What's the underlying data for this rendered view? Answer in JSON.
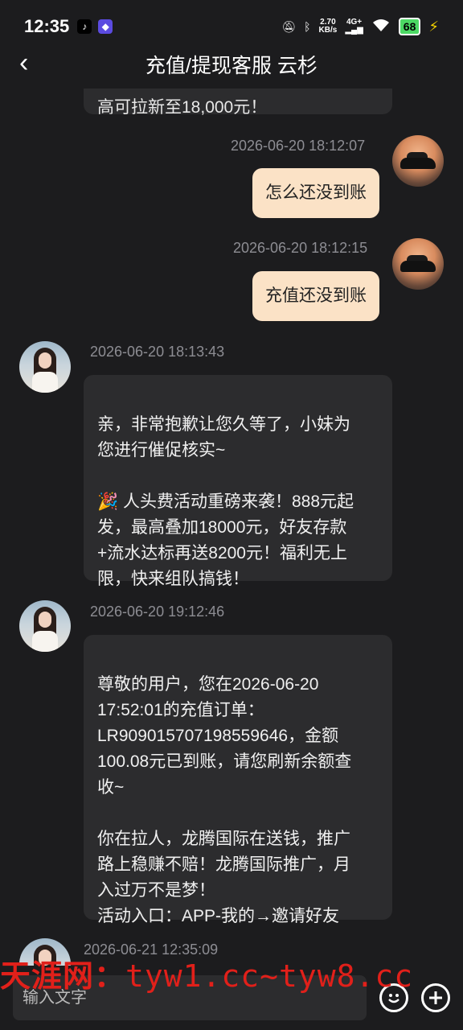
{
  "status_bar": {
    "time": "12:35",
    "net_speed_value": "2.70",
    "net_speed_unit": "KB/s",
    "signal_label": "4G+",
    "battery": "68"
  },
  "header": {
    "title": "充值/提现客服 云杉"
  },
  "messages": [
    {
      "side": "left",
      "partial": true,
      "text": "高可拉新至18,000元！"
    },
    {
      "side": "right",
      "timestamp": "2026-06-20 18:12:07",
      "text": "怎么还没到账"
    },
    {
      "side": "right",
      "timestamp": "2026-06-20 18:12:15",
      "text": "充值还没到账"
    },
    {
      "side": "left",
      "timestamp": "2026-06-20 18:13:43",
      "text": "亲，非常抱歉让您久等了，小妹为\n您进行催促核实~\n\n🎉 人头费活动重磅来袭！888元起\n发，最高叠加18000元，好友存款\n+流水达标再送8200元！福利无上\n限，快来组队搞钱！"
    },
    {
      "side": "left",
      "timestamp": "2026-06-20 19:12:46",
      "text": "尊敬的用户，您在2026-06-20\n17:52:01的充值订单：\nLR909015707198559646，金额\n100.08元已到账，请您刷新余额查\n收~\n\n你在拉人，龙腾国际在送钱，推广\n路上稳赚不赔！龙腾国际推广，月\n入过万不是梦！\n活动入口：APP-我的→邀请好友"
    },
    {
      "side": "left",
      "timestamp": "2026-06-21 12:35:09",
      "partial": true
    }
  ],
  "input": {
    "placeholder": "输入文字"
  },
  "watermark": {
    "site": "天涯网：",
    "url": "tyw1.cc~tyw8.cc"
  },
  "colors": {
    "background": "#1c1c1e",
    "bubble_left": "#2c2c2e",
    "bubble_right": "#fbe2c6",
    "timestamp": "#8d8d93",
    "watermark": "#e1201a"
  }
}
